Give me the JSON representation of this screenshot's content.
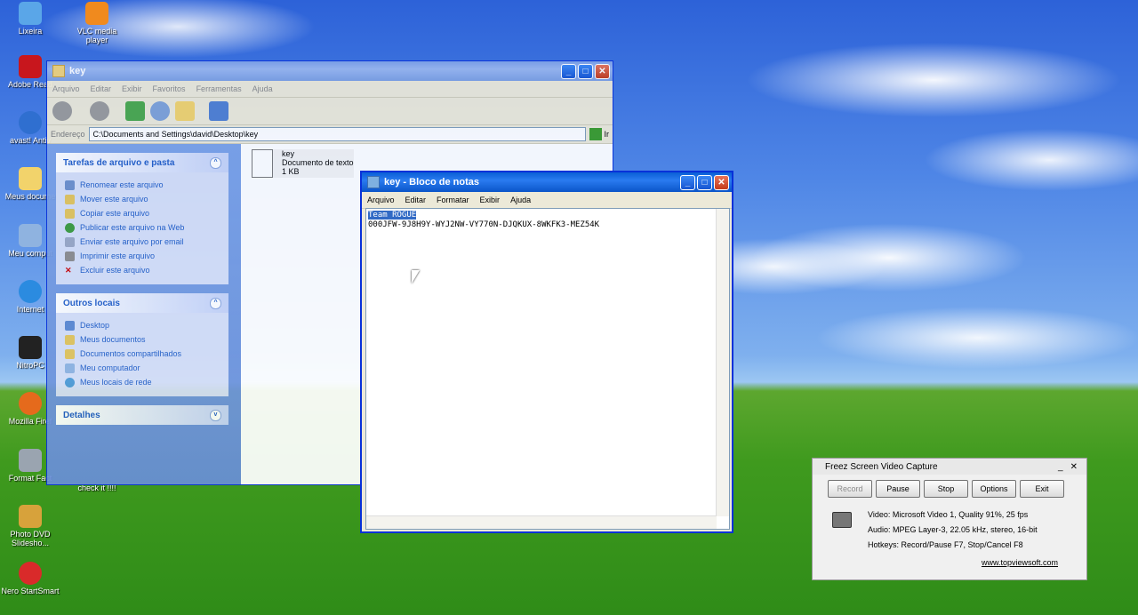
{
  "desktop": {
    "icons": [
      {
        "label": "Lixeira"
      },
      {
        "label": "VLC media player"
      },
      {
        "label": "Adobe Read"
      },
      {
        "label": "avast! Antiv"
      },
      {
        "label": "Meus docume"
      },
      {
        "label": "Meu comput"
      },
      {
        "label": "Internet"
      },
      {
        "label": "NitroPC"
      },
      {
        "label": "Mozilla Firef"
      },
      {
        "label": "Format Fact"
      },
      {
        "label": "Photo DVD Slidesho..."
      },
      {
        "label": "Nero StartSmart"
      },
      {
        "label": "check it !!!!"
      }
    ]
  },
  "explorer": {
    "title": "key",
    "menu": [
      "Arquivo",
      "Editar",
      "Exibir",
      "Favoritos",
      "Ferramentas",
      "Ajuda"
    ],
    "address_label": "Endereço",
    "address_value": "C:\\Documents and Settings\\david\\Desktop\\key",
    "go_label": "Ir",
    "tasks_panel": {
      "title": "Tarefas de arquivo e pasta",
      "items": [
        "Renomear este arquivo",
        "Mover este arquivo",
        "Copiar este arquivo",
        "Publicar este arquivo na Web",
        "Enviar este arquivo por email",
        "Imprimir este arquivo",
        "Excluir este arquivo"
      ]
    },
    "places_panel": {
      "title": "Outros locais",
      "items": [
        "Desktop",
        "Meus documentos",
        "Documentos compartilhados",
        "Meu computador",
        "Meus locais de rede"
      ]
    },
    "details_panel": {
      "title": "Detalhes"
    },
    "file": {
      "name": "key",
      "type": "Documento de texto",
      "size": "1 KB"
    }
  },
  "notepad": {
    "title": "key - Bloco de notas",
    "menu": [
      "Arquivo",
      "Editar",
      "Formatar",
      "Exibir",
      "Ajuda"
    ],
    "line1_selected": "Team ROGUE",
    "line2": "000JFW-9J8H9Y-WYJ2NW-VY770N-DJQKUX-8WKFK3-MEZ54K"
  },
  "freez": {
    "title": "Freez Screen Video Capture",
    "buttons": [
      "Record",
      "Pause",
      "Stop",
      "Options",
      "Exit"
    ],
    "video": "Video: Microsoft Video 1, Quality 91%, 25 fps",
    "audio": "Audio: MPEG Layer-3, 22.05 kHz, stereo, 16-bit",
    "hotkeys": "Hotkeys: Record/Pause F7, Stop/Cancel F8",
    "link": "www.topviewsoft.com"
  }
}
